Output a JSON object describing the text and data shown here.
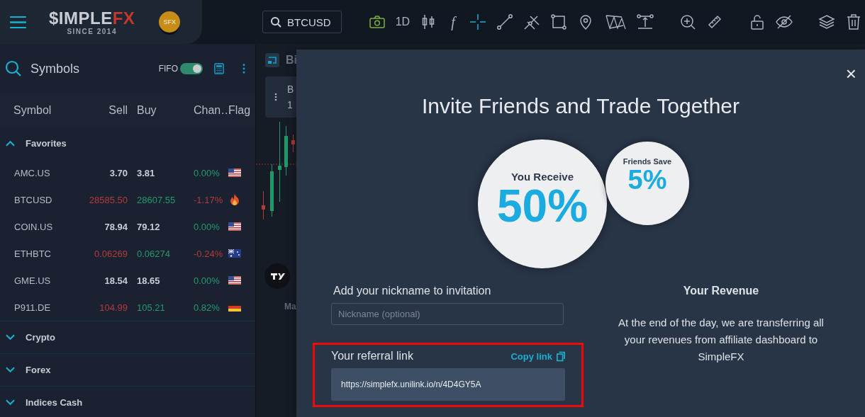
{
  "header": {
    "logo_main": "$IMPLE",
    "logo_accent": "FX",
    "logo_sub": "SINCE 2014",
    "coin": "SFX"
  },
  "toolbar": {
    "search": "BTCUSD",
    "timeframe": "1D",
    "formula": "f"
  },
  "symbols": {
    "title": "Symbols",
    "fifo": {
      "label": "FIFO",
      "on": true
    },
    "columns": [
      "Symbol",
      "Sell",
      "Buy",
      "Chan…",
      "Flag"
    ],
    "groups": [
      {
        "name": "Favorites",
        "expanded": true,
        "rows": [
          {
            "symbol": "AMC.US",
            "sell": "3.70",
            "buy": "3.81",
            "change": "0.00%",
            "price_moved": false,
            "falling": false,
            "kind": "us"
          },
          {
            "symbol": "BTCUSD",
            "sell": "28585.50",
            "buy": "28607.55",
            "change": "-1.17%",
            "price_moved": true,
            "falling": true,
            "kind": "fire"
          },
          {
            "symbol": "COIN.US",
            "sell": "78.94",
            "buy": "79.12",
            "change": "0.00%",
            "price_moved": false,
            "falling": false,
            "kind": "us"
          },
          {
            "symbol": "ETHBTC",
            "sell": "0.06269",
            "buy": "0.06274",
            "change": "-0.24%",
            "price_moved": true,
            "falling": true,
            "kind": "au"
          },
          {
            "symbol": "GME.US",
            "sell": "18.54",
            "buy": "18.65",
            "change": "0.00%",
            "price_moved": false,
            "falling": false,
            "kind": "us"
          },
          {
            "symbol": "P911.DE",
            "sell": "104.99",
            "buy": "105.21",
            "change": "0.82%",
            "price_moved": true,
            "falling": false,
            "kind": "de"
          }
        ]
      },
      {
        "name": "Crypto",
        "expanded": false
      },
      {
        "name": "Forex",
        "expanded": false
      },
      {
        "name": "Indices Cash",
        "expanded": false
      }
    ]
  },
  "chart": {
    "tab": "Bi",
    "card_line_1": "B",
    "card_line_2": "1",
    "axis_label": "Ma"
  },
  "modal": {
    "close": "×",
    "title": "Invite Friends and Trade Together",
    "receive": {
      "label": "You Receive",
      "value": "50%"
    },
    "save": {
      "label": "Friends Save",
      "value": "5%"
    },
    "nickname": {
      "label": "Add your nickname to invitation",
      "placeholder": "Nickname (optional)"
    },
    "referral": {
      "label": "Your referral link",
      "copy": "Copy link",
      "link": "https://simplefx.unilink.io/n/4D4GY5A",
      "highlighted": true
    },
    "revenue": {
      "title": "Your Revenue",
      "text": "At the end of the day, we are transferring all your revenues from affiliate dashboard to SimpleFX"
    }
  }
}
